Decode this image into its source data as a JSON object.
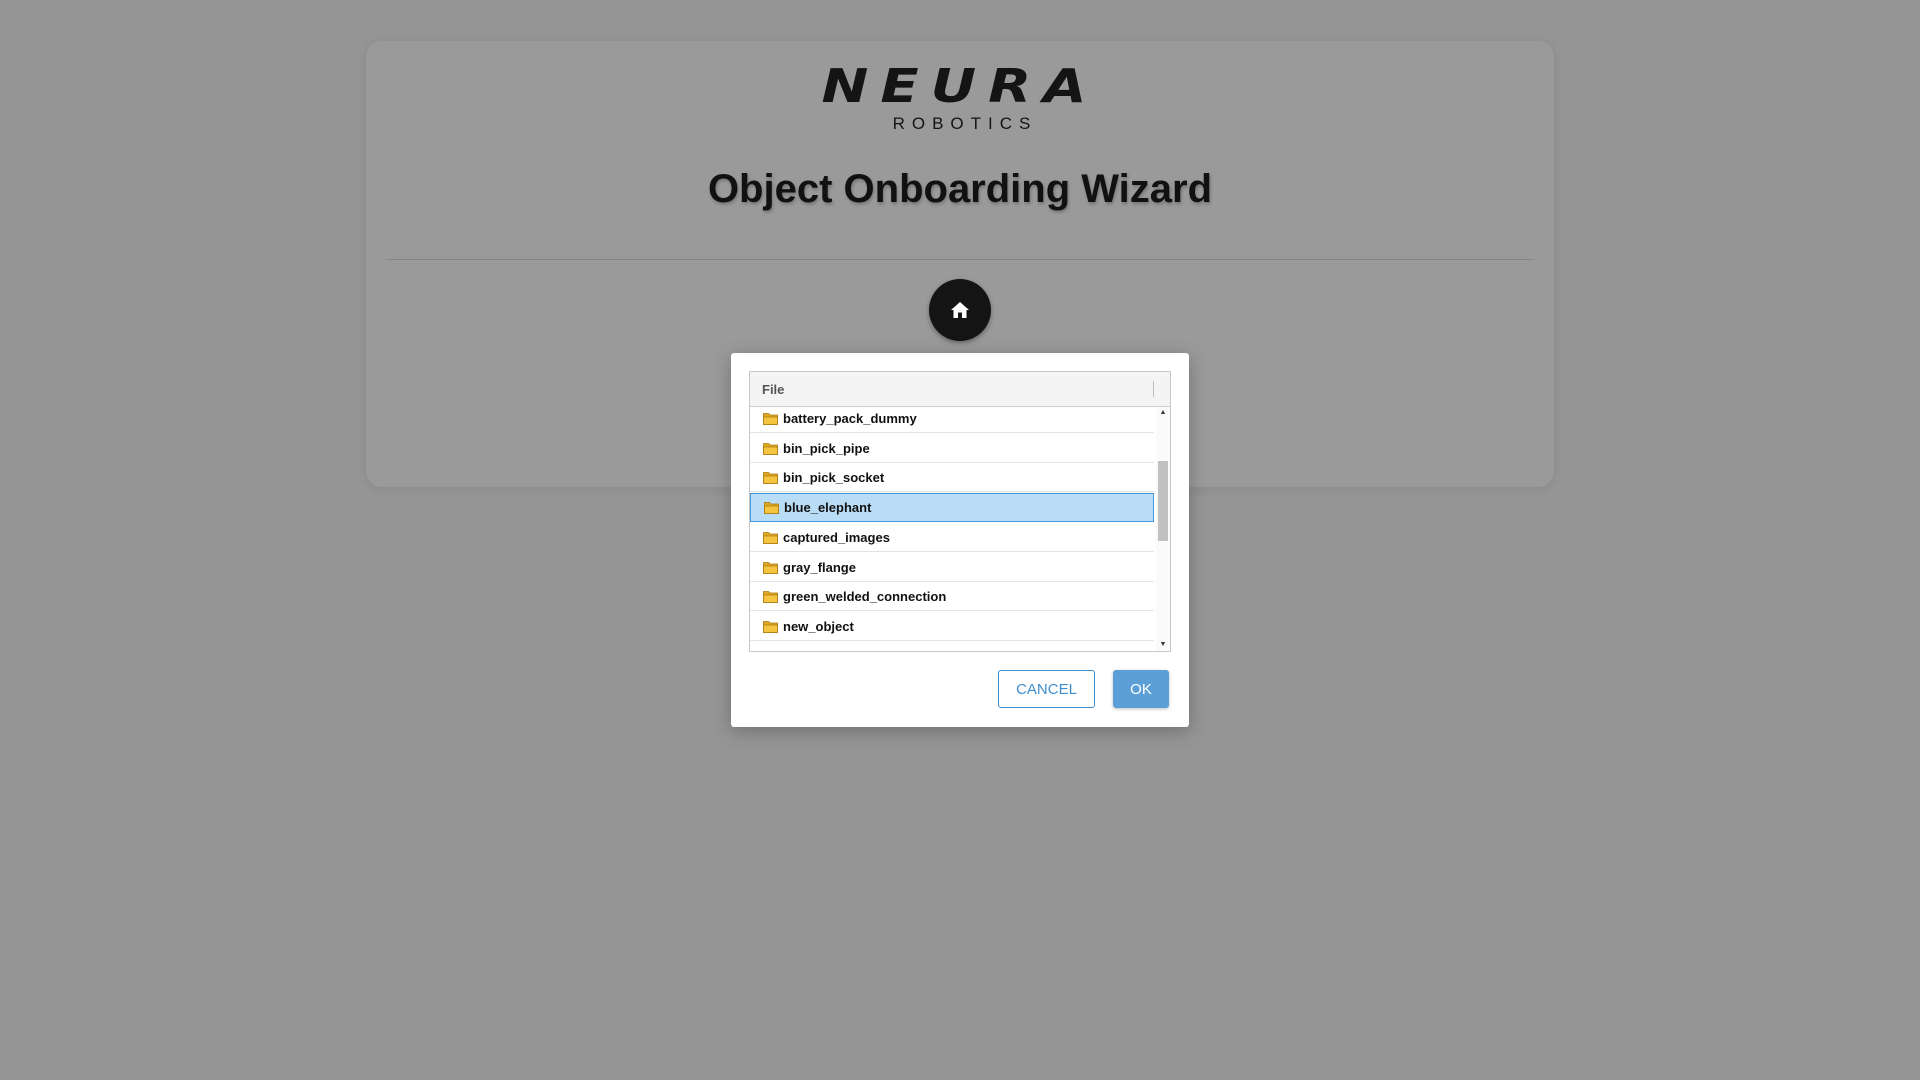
{
  "brand": {
    "name": "NEURA",
    "tagline": "ROBOTICS"
  },
  "page": {
    "title": "Object Onboarding Wizard"
  },
  "home_button": {
    "icon": "home-icon"
  },
  "dialog": {
    "column_header": "File",
    "items": [
      {
        "label": "battery_pack_dummy",
        "selected": false
      },
      {
        "label": "bin_pick_pipe",
        "selected": false
      },
      {
        "label": "bin_pick_socket",
        "selected": false
      },
      {
        "label": "blue_elephant",
        "selected": true
      },
      {
        "label": "captured_images",
        "selected": false
      },
      {
        "label": "gray_flange",
        "selected": false
      },
      {
        "label": "green_welded_connection",
        "selected": false
      },
      {
        "label": "new_object",
        "selected": false
      }
    ],
    "cancel_label": "CANCEL",
    "ok_label": "OK"
  },
  "colors": {
    "overlay": "#959595",
    "accent": "#3f8fd0",
    "selection": "#b9ddf6",
    "folder": "#f5c542"
  }
}
